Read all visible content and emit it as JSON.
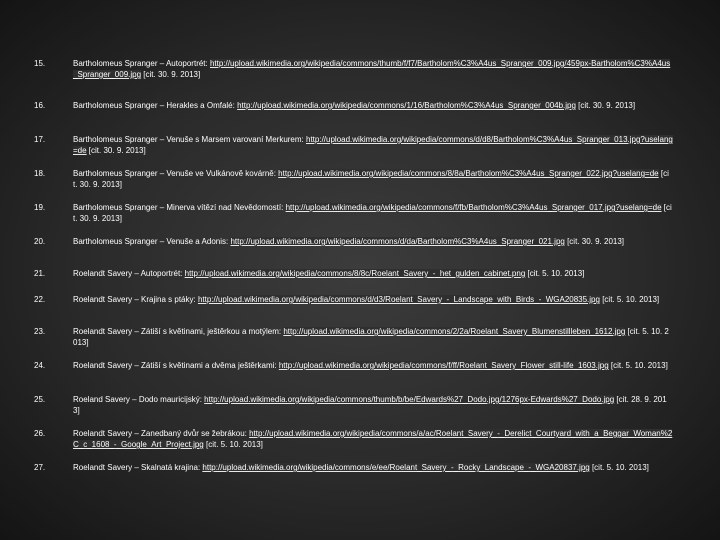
{
  "entries": [
    {
      "num": "15.",
      "lead": "Bartholomeus Spranger – Autoportrét: ",
      "url": "http://upload.wikimedia.org/wikipedia/commons/thumb/f/f7/Bartholom%C3%A4us_Spranger_009.jpg/459px-Bartholom%C3%A4us_Spranger_009.jpg",
      "cit": " [cit. 30. 9. 2013]"
    },
    {
      "num": "16.",
      "lead": "Bartholomeus Spranger – Herakles a Omfalé: ",
      "url": "http://upload.wikimedia.org/wikipedia/commons/1/16/Bartholom%C3%A4us_Spranger_004b.jpg",
      "cit": " [cit. 30. 9. 2013]"
    },
    {
      "num": "17.",
      "lead": "Bartholomeus Spranger – Venuše s Marsem varovaní Merkurem: ",
      "url": "http://upload.wikimedia.org/wikipedia/commons/d/d8/Bartholom%C3%A4us_Spranger_013.jpg?uselang=de",
      "cit": " [cit. 30. 9. 2013]"
    },
    {
      "num": "18.",
      "lead": "Bartholomeus Spranger – Venuše ve Vulkánově kovárně: ",
      "url": "http://upload.wikimedia.org/wikipedia/commons/8/8a/Bartholom%C3%A4us_Spranger_022.jpg?uselang=de",
      "cit": " [cit. 30. 9. 2013]"
    },
    {
      "num": "19.",
      "lead": "Bartholomeus Spranger – Minerva vítězí nad Nevědomostí: ",
      "url": "http://upload.wikimedia.org/wikipedia/commons/f/fb/Bartholom%C3%A4us_Spranger_017.jpg?uselang=de",
      "cit": " [cit. 30. 9. 2013]"
    },
    {
      "num": "20.",
      "lead": "Bartholomeus Spranger – Venuše a Adonis: ",
      "url": "http://upload.wikimedia.org/wikipedia/commons/d/da/Bartholom%C3%A4us_Spranger_021.jpg",
      "cit": " [cit. 30. 9. 2013]"
    },
    {
      "num": "21.",
      "lead": "Roelandt Savery – Autoportrét: ",
      "url": "http://upload.wikimedia.org/wikipedia/commons/8/8c/Roelant_Savery_-_het_gulden_cabinet.png",
      "cit": " [cit. 5. 10. 2013]"
    },
    {
      "num": "22.",
      "lead": "Roelandt Savery – Krajina s ptáky: ",
      "url": "http://upload.wikimedia.org/wikipedia/commons/d/d3/Roelant_Savery_-_Landscape_with_Birds_-_WGA20835.jpg",
      "cit": " [cit. 5. 10. 2013]"
    },
    {
      "num": "23.",
      "lead": "Roelandt Savery – Zátiší s květinami, ještěrkou a motýlem: ",
      "url": "http://upload.wikimedia.org/wikipedia/commons/2/2a/Roelant_Savery_Blumenstillleben_1612.jpg",
      "cit": " [cit. 5. 10. 2013]"
    },
    {
      "num": "24.",
      "lead": "Roelandt Savery – Zátiší s květinami a dvěma ještěrkami: ",
      "url": "http://upload.wikimedia.org/wikipedia/commons/f/ff/Roelant_Savery_Flower_still-life_1603.jpg",
      "cit": " [cit. 5. 10. 2013]"
    },
    {
      "num": "25.",
      "lead": "Roeland Savery – Dodo mauricijský: ",
      "url": "http://upload.wikimedia.org/wikipedia/commons/thumb/b/be/Edwards%27_Dodo.jpg/1276px-Edwards%27_Dodo.jpg",
      "cit": " [cit. 28. 9. 2013]"
    },
    {
      "num": "26.",
      "lead": "Roelandt Savery – Zanedbaný dvůr se žebrákou: ",
      "url": "http://upload.wikimedia.org/wikipedia/commons/a/ac/Roelant_Savery_-_Derelict_Courtyard_with_a_Beggar_Woman%2C_c_1608_-_Google_Art_Project.jpg",
      "cit": " [cit. 5. 10. 2013]"
    },
    {
      "num": "27.",
      "lead": "Roelandt Savery – Skalnatá krajina: ",
      "url": "http://upload.wikimedia.org/wikipedia/commons/e/ee/Roelant_Savery_-_Rocky_Landscape_-_WGA20837.jpg",
      "cit": " [cit. 5. 10. 2013]"
    }
  ]
}
